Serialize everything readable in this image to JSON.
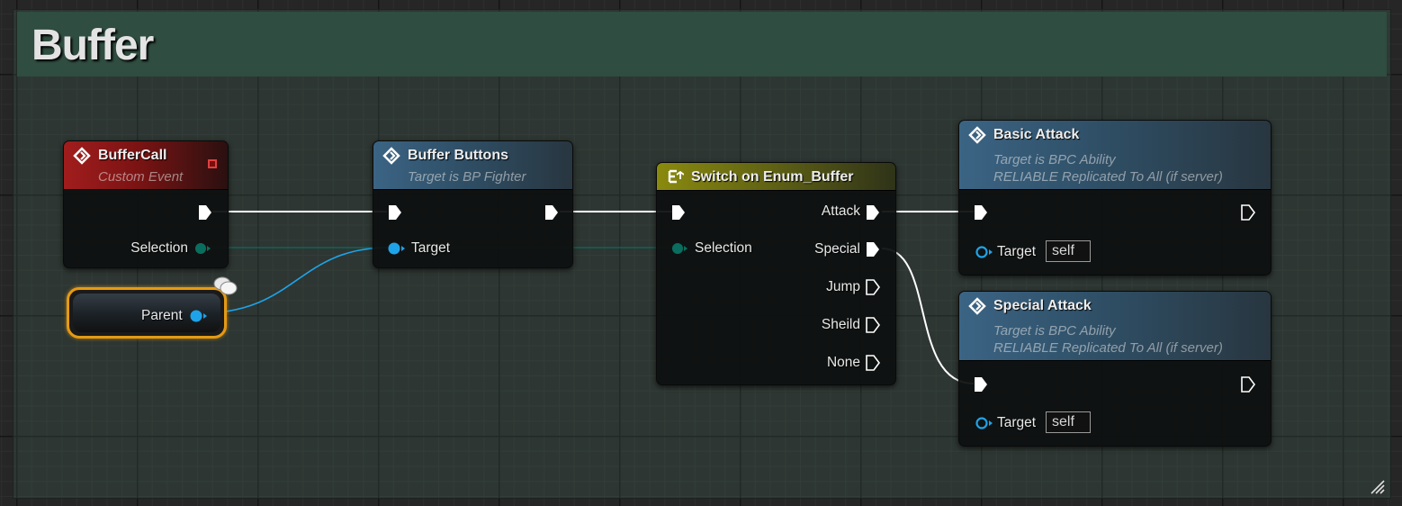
{
  "comment": {
    "title": "Buffer"
  },
  "nodes": {
    "buffer_call": {
      "title": "BufferCall",
      "subtitle": "Custom Event",
      "pins": {
        "selection": "Selection"
      }
    },
    "parent": {
      "label": "Parent"
    },
    "buffer_buttons": {
      "title": "Buffer Buttons",
      "subtitle": "Target is BP Fighter",
      "pins": {
        "target": "Target"
      }
    },
    "switch": {
      "title": "Switch on Enum_Buffer",
      "pins": {
        "selection": "Selection",
        "attack": "Attack",
        "special": "Special",
        "jump": "Jump",
        "sheild": "Sheild",
        "none": "None"
      }
    },
    "basic_attack": {
      "title": "Basic Attack",
      "subtitle1": "Target is BPC Ability",
      "subtitle2": "RELIABLE Replicated To All (if server)",
      "pins": {
        "target": "Target",
        "target_value": "self"
      }
    },
    "special_attack": {
      "title": "Special Attack",
      "subtitle1": "Target is BPC Ability",
      "subtitle2": "RELIABLE Replicated To All (if server)",
      "pins": {
        "target": "Target",
        "target_value": "self"
      }
    }
  },
  "icons": {
    "event": "diamond-event-icon",
    "function": "diamond-function-icon",
    "switch": "switch-enum-icon",
    "exec_pin": "exec-arrow-icon",
    "object_pin": "object-pin-icon",
    "byte_pin": "byte-pin-icon",
    "comment": "comment-bubble-icon"
  },
  "colors": {
    "event_header": "#a11d1d",
    "function_header": "#3b6484",
    "switch_header": "#8a8a0e",
    "object_pin": "#1fa3e8",
    "byte_pin": "#0a6e5f",
    "exec_wire": "#ffffff",
    "comment_header": "#2f4d40",
    "parent_outline": "#e59a12"
  }
}
